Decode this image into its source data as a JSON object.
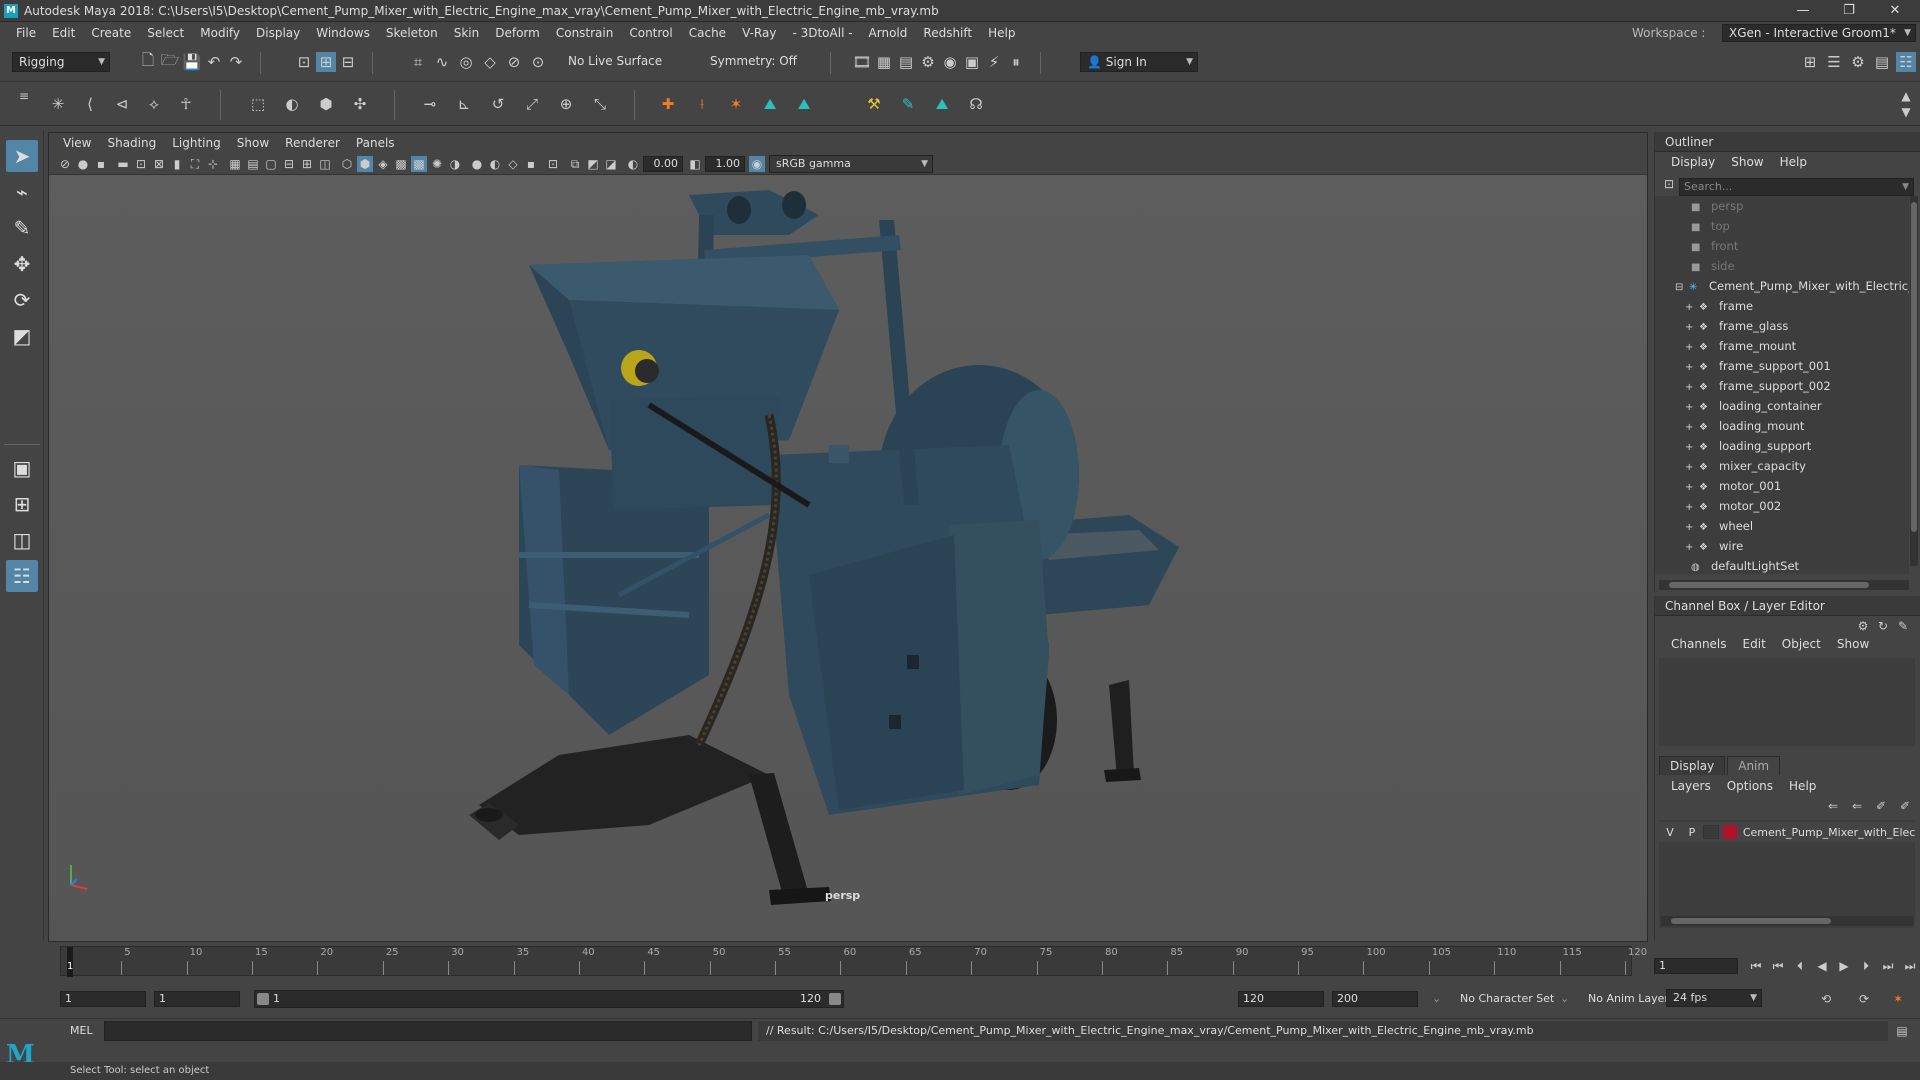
{
  "window": {
    "title": "Autodesk Maya 2018: C:\\Users\\I5\\Desktop\\Cement_Pump_Mixer_with_Electric_Engine_max_vray\\Cement_Pump_Mixer_with_Electric_Engine_mb_vray.mb",
    "minimize": "—",
    "restore": "❐",
    "close": "✕"
  },
  "menubar": {
    "items": [
      "File",
      "Edit",
      "Create",
      "Select",
      "Modify",
      "Display",
      "Windows",
      "Skeleton",
      "Skin",
      "Deform",
      "Constrain",
      "Control",
      "Cache",
      "V-Ray",
      "- 3DtoAll -",
      "Arnold",
      "Redshift",
      "Help"
    ]
  },
  "workspace": {
    "label": "Workspace :",
    "value": "XGen - Interactive Groom1*"
  },
  "statusline": {
    "menuset": "Rigging",
    "live_surface": "No Live Surface",
    "symmetry": "Symmetry: Off",
    "sign_in": "Sign In"
  },
  "viewport": {
    "menus": [
      "View",
      "Shading",
      "Lighting",
      "Show",
      "Renderer",
      "Panels"
    ],
    "exposure": "0.00",
    "gamma": "1.00",
    "color_space": "sRGB gamma",
    "camera_label": "persp"
  },
  "outliner": {
    "title": "Outliner",
    "menus": [
      "Display",
      "Show",
      "Help"
    ],
    "search_placeholder": "Search...",
    "cameras": [
      "persp",
      "top",
      "front",
      "side"
    ],
    "group": "Cement_Pump_Mixer_with_Electric_En",
    "children": [
      "frame",
      "frame_glass",
      "frame_mount",
      "frame_support_001",
      "frame_support_002",
      "loading_container",
      "loading_mount",
      "loading_support",
      "mixer_capacity",
      "motor_001",
      "motor_002",
      "wheel",
      "wire"
    ],
    "light_set": "defaultLightSet"
  },
  "channelbox": {
    "title": "Channel Box / Layer Editor",
    "menus": [
      "Channels",
      "Edit",
      "Object",
      "Show"
    ],
    "tabs": [
      "Display",
      "Anim"
    ],
    "layer_menus": [
      "Layers",
      "Options",
      "Help"
    ],
    "layer": {
      "v": "V",
      "p": "P",
      "name": "Cement_Pump_Mixer_with_Elec",
      "color": "#b0122a"
    }
  },
  "timeline": {
    "labels": [
      "1",
      "5",
      "10",
      "15",
      "20",
      "25",
      "30",
      "35",
      "40",
      "45",
      "50",
      "55",
      "60",
      "65",
      "70",
      "75",
      "80",
      "85",
      "90",
      "95",
      "100",
      "105",
      "110",
      "115",
      "120"
    ],
    "current_frame": "1"
  },
  "range": {
    "start": "1",
    "playback_start": "1",
    "slider_start": "1",
    "slider_end": "120",
    "playback_end": "120",
    "end": "200",
    "character_set": "No Character Set",
    "anim_layer": "No Anim Layer",
    "fps": "24 fps"
  },
  "cmdline": {
    "lang": "MEL",
    "result": "// Result: C:/Users/I5/Desktop/Cement_Pump_Mixer_with_Electric_Engine_max_vray/Cement_Pump_Mixer_with_Electric_Engine_mb_vray.mb"
  },
  "helpline": {
    "text": "Select Tool: select an object"
  },
  "colors": {
    "accent": "#5285a6",
    "machine": "#2f4a5c",
    "maya_logo": "#1fa6c9"
  }
}
